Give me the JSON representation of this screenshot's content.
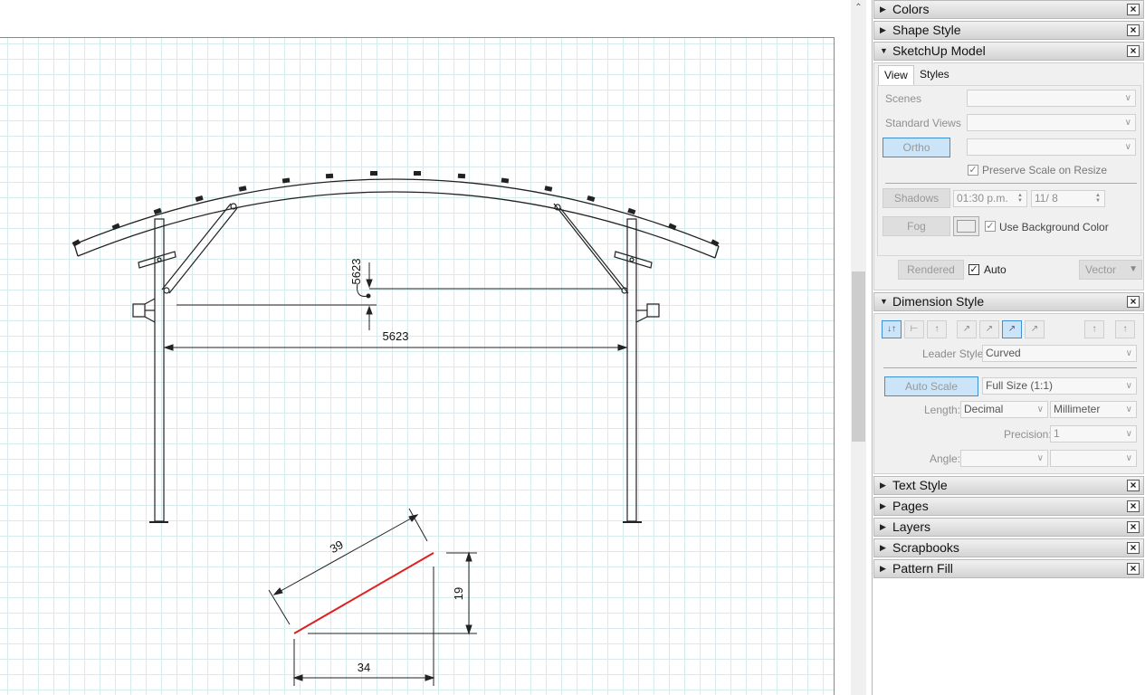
{
  "drawing": {
    "dimension_top_vertical": "5623",
    "dimension_span": "5623",
    "triangle_hypotenuse": "39",
    "triangle_height": "19",
    "triangle_base": "34",
    "triangle_line_color": "#e02020"
  },
  "panels": {
    "colors": {
      "title": "Colors",
      "expanded": false
    },
    "shape_style": {
      "title": "Shape Style",
      "expanded": false
    },
    "sketchup_model": {
      "title": "SketchUp Model",
      "expanded": true,
      "tabs": [
        "View",
        "Styles"
      ],
      "selected_tab": "View",
      "scenes_label": "Scenes",
      "standard_views_label": "Standard Views",
      "ortho_button": "Ortho",
      "preserve_scale_label": "Preserve Scale on Resize",
      "preserve_scale_checked": true,
      "shadows_button": "Shadows",
      "shadow_time": "01:30 p.m.",
      "shadow_date": "11/  8",
      "fog_button": "Fog",
      "use_background_color_label": "Use Background Color",
      "use_background_color_checked": true,
      "rendered_button": "Rendered",
      "auto_label": "Auto",
      "auto_checked": true,
      "vector_button": "Vector"
    },
    "dimension_style": {
      "title": "Dimension Style",
      "expanded": true,
      "leader_style_label": "Leader Style:",
      "leader_style_value": "Curved",
      "auto_scale_button": "Auto Scale",
      "scale_value": "Full Size (1:1)",
      "length_label": "Length:",
      "length_format": "Decimal",
      "length_unit": "Millimeter",
      "precision_label": "Precision:",
      "precision_value": "1",
      "angle_label": "Angle:",
      "angle_format": "",
      "angle_unit": ""
    },
    "text_style": {
      "title": "Text Style",
      "expanded": false
    },
    "pages": {
      "title": "Pages",
      "expanded": false
    },
    "layers": {
      "title": "Layers",
      "expanded": false
    },
    "scrapbooks": {
      "title": "Scrapbooks",
      "expanded": false
    },
    "pattern_fill": {
      "title": "Pattern Fill",
      "expanded": false
    }
  }
}
